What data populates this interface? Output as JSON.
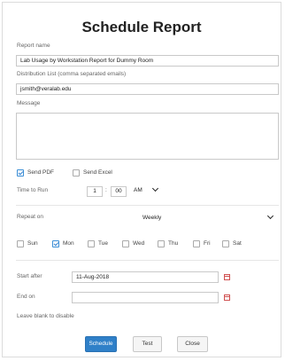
{
  "dialog": {
    "title": "Schedule Report"
  },
  "form": {
    "report_name_label": "Report name",
    "report_name_value": "Lab Usage by Workstation Report for Dummy Room",
    "distribution_label": "Distribution List (comma separated emails)",
    "distribution_value": "jsmith@veralab.edu",
    "message_label": "Message",
    "message_value": "",
    "send_pdf": {
      "label": "Send PDF",
      "checked": true
    },
    "send_excel": {
      "label": "Send Excel",
      "checked": false
    },
    "time_to_run_label": "Time to Run",
    "time_hour": "1",
    "time_sep": ":",
    "time_minute": "00",
    "time_ampm": "AM",
    "repeat_on_label": "Repeat on",
    "repeat_value": "Weekly",
    "days": [
      {
        "label": "Sun",
        "checked": false
      },
      {
        "label": "Mon",
        "checked": true
      },
      {
        "label": "Tue",
        "checked": false
      },
      {
        "label": "Wed",
        "checked": false
      },
      {
        "label": "Thu",
        "checked": false
      },
      {
        "label": "Fri",
        "checked": false
      },
      {
        "label": "Sat",
        "checked": false
      }
    ],
    "start_after_label": "Start after",
    "start_after_value": "11-Aug-2018",
    "end_on_label": "End on",
    "end_on_value": "",
    "hint": "Leave blank to disable"
  },
  "buttons": {
    "schedule": "Schedule",
    "test": "Test",
    "close": "Close"
  },
  "colors": {
    "primary": "#2f80c8",
    "checkbox_accent": "#3b8fd6",
    "calendar_icon": "#d05050"
  }
}
